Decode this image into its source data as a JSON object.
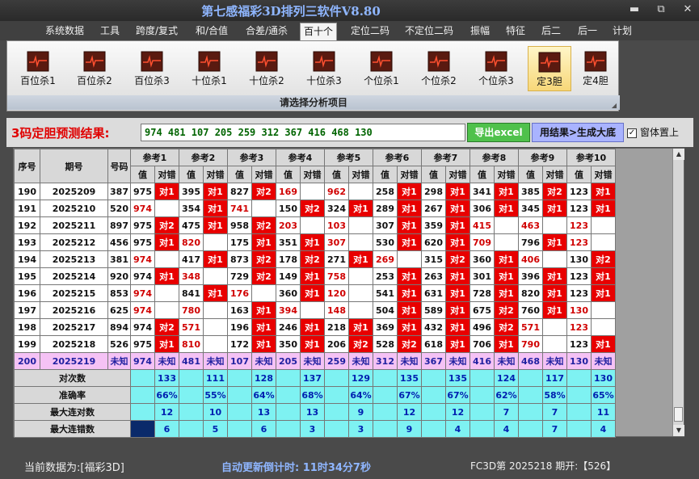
{
  "window": {
    "title": "第七感福彩3D排列三软件V8.80",
    "minimize": "▬",
    "restore": "⧉",
    "close": "✕"
  },
  "menu": [
    "系统数据",
    "工具",
    "跨度/复式",
    "和/合值",
    "合差/通杀",
    "百十个",
    "定位二码",
    "不定位二码",
    "振幅",
    "特征",
    "后二",
    "后一",
    "计划"
  ],
  "menu_active": "百十个",
  "ribbon": {
    "buttons": [
      "百位杀1",
      "百位杀2",
      "百位杀3",
      "十位杀1",
      "十位杀2",
      "十位杀3",
      "个位杀1",
      "个位杀2",
      "个位杀3",
      "定3胆",
      "定4胆"
    ],
    "selected": "定3胆",
    "icon": "chart-icon",
    "caption": "请选择分析项目"
  },
  "result": {
    "label": "3码定胆预测结果:",
    "value": "974 481 107 205 259 312 367 416 468 130",
    "excel_button": "导出excel",
    "generate_button": "用结果>生成大底",
    "topmost_label": "窗体置上",
    "topmost_checked": true
  },
  "table": {
    "col_headers": {
      "seq": "序号",
      "period": "期号",
      "number": "号码"
    },
    "groups": [
      "参考1",
      "参考2",
      "参考3",
      "参考4",
      "参考5",
      "参考6",
      "参考7",
      "参考8",
      "参考9",
      "参考10"
    ],
    "sub_headers": [
      "值",
      "对错"
    ],
    "rows": [
      {
        "seq": "190",
        "period": "2025209",
        "num": "387",
        "cells": [
          [
            "975",
            "对1",
            "dark",
            1
          ],
          [
            "395",
            "对1",
            "dark",
            1
          ],
          [
            "827",
            "对2",
            "dark",
            1
          ],
          [
            "169",
            "",
            "red",
            0
          ],
          [
            "962",
            "",
            "red",
            0
          ],
          [
            "258",
            "对1",
            "dark",
            1
          ],
          [
            "298",
            "对1",
            "dark",
            1
          ],
          [
            "341",
            "对1",
            "dark",
            1
          ],
          [
            "385",
            "对2",
            "dark",
            1
          ],
          [
            "123",
            "对1",
            "dark",
            1
          ]
        ]
      },
      {
        "seq": "191",
        "period": "2025210",
        "num": "520",
        "cells": [
          [
            "974",
            "",
            "red",
            0
          ],
          [
            "354",
            "对1",
            "dark",
            1
          ],
          [
            "741",
            "",
            "red",
            0
          ],
          [
            "150",
            "对2",
            "dark",
            1
          ],
          [
            "324",
            "对1",
            "dark",
            1
          ],
          [
            "289",
            "对1",
            "dark",
            1
          ],
          [
            "267",
            "对1",
            "dark",
            1
          ],
          [
            "306",
            "对1",
            "dark",
            1
          ],
          [
            "345",
            "对1",
            "dark",
            1
          ],
          [
            "123",
            "对1",
            "dark",
            1
          ]
        ]
      },
      {
        "seq": "192",
        "period": "2025211",
        "num": "897",
        "cells": [
          [
            "975",
            "对2",
            "dark",
            1
          ],
          [
            "475",
            "对1",
            "dark",
            1
          ],
          [
            "958",
            "对2",
            "dark",
            1
          ],
          [
            "203",
            "",
            "red",
            0
          ],
          [
            "103",
            "",
            "red",
            0
          ],
          [
            "307",
            "对1",
            "dark",
            1
          ],
          [
            "359",
            "对1",
            "dark",
            1
          ],
          [
            "415",
            "",
            "red",
            0
          ],
          [
            "463",
            "",
            "red",
            0
          ],
          [
            "123",
            "",
            "red",
            0
          ]
        ]
      },
      {
        "seq": "193",
        "period": "2025212",
        "num": "456",
        "cells": [
          [
            "975",
            "对1",
            "dark",
            1
          ],
          [
            "820",
            "",
            "red",
            0
          ],
          [
            "175",
            "对1",
            "dark",
            1
          ],
          [
            "351",
            "对1",
            "dark",
            1
          ],
          [
            "307",
            "",
            "red",
            0
          ],
          [
            "530",
            "对1",
            "dark",
            1
          ],
          [
            "620",
            "对1",
            "dark",
            1
          ],
          [
            "709",
            "",
            "red",
            0
          ],
          [
            "796",
            "对1",
            "dark",
            1
          ],
          [
            "123",
            "",
            "red",
            0
          ]
        ]
      },
      {
        "seq": "194",
        "period": "2025213",
        "num": "381",
        "cells": [
          [
            "974",
            "",
            "red",
            0
          ],
          [
            "417",
            "对1",
            "dark",
            1
          ],
          [
            "873",
            "对2",
            "dark",
            1
          ],
          [
            "178",
            "对2",
            "dark",
            1
          ],
          [
            "271",
            "对1",
            "dark",
            1
          ],
          [
            "269",
            "",
            "red",
            0
          ],
          [
            "315",
            "对2",
            "dark",
            1
          ],
          [
            "360",
            "对1",
            "dark",
            1
          ],
          [
            "406",
            "",
            "red",
            0
          ],
          [
            "130",
            "对2",
            "dark",
            1
          ]
        ]
      },
      {
        "seq": "195",
        "period": "2025214",
        "num": "920",
        "cells": [
          [
            "974",
            "对1",
            "dark",
            1
          ],
          [
            "348",
            "",
            "red",
            0
          ],
          [
            "729",
            "对2",
            "dark",
            1
          ],
          [
            "149",
            "对1",
            "dark",
            1
          ],
          [
            "758",
            "",
            "red",
            0
          ],
          [
            "253",
            "对1",
            "dark",
            1
          ],
          [
            "263",
            "对1",
            "dark",
            1
          ],
          [
            "301",
            "对1",
            "dark",
            1
          ],
          [
            "396",
            "对1",
            "dark",
            1
          ],
          [
            "123",
            "对1",
            "dark",
            1
          ]
        ]
      },
      {
        "seq": "196",
        "period": "2025215",
        "num": "853",
        "cells": [
          [
            "974",
            "",
            "red",
            0
          ],
          [
            "841",
            "对1",
            "dark",
            1
          ],
          [
            "176",
            "",
            "red",
            0
          ],
          [
            "360",
            "对1",
            "dark",
            1
          ],
          [
            "120",
            "",
            "red",
            0
          ],
          [
            "541",
            "对1",
            "dark",
            1
          ],
          [
            "631",
            "对1",
            "dark",
            1
          ],
          [
            "728",
            "对1",
            "dark",
            1
          ],
          [
            "820",
            "对1",
            "dark",
            1
          ],
          [
            "123",
            "对1",
            "dark",
            1
          ]
        ]
      },
      {
        "seq": "197",
        "period": "2025216",
        "num": "625",
        "cells": [
          [
            "974",
            "",
            "red",
            0
          ],
          [
            "780",
            "",
            "red",
            0
          ],
          [
            "163",
            "对1",
            "dark",
            1
          ],
          [
            "394",
            "",
            "red",
            0
          ],
          [
            "148",
            "",
            "red",
            0
          ],
          [
            "504",
            "对1",
            "dark",
            1
          ],
          [
            "589",
            "对1",
            "dark",
            1
          ],
          [
            "675",
            "对2",
            "dark",
            1
          ],
          [
            "760",
            "对1",
            "dark",
            1
          ],
          [
            "130",
            "",
            "red",
            0
          ]
        ]
      },
      {
        "seq": "198",
        "period": "2025217",
        "num": "894",
        "cells": [
          [
            "974",
            "对2",
            "dark",
            1
          ],
          [
            "571",
            "",
            "red",
            0
          ],
          [
            "196",
            "对1",
            "dark",
            1
          ],
          [
            "246",
            "对1",
            "dark",
            1
          ],
          [
            "218",
            "对1",
            "dark",
            1
          ],
          [
            "369",
            "对1",
            "dark",
            1
          ],
          [
            "432",
            "对1",
            "dark",
            1
          ],
          [
            "496",
            "对2",
            "dark",
            1
          ],
          [
            "571",
            "",
            "red",
            0
          ],
          [
            "123",
            "",
            "red",
            0
          ]
        ]
      },
      {
        "seq": "199",
        "period": "2025218",
        "num": "526",
        "cells": [
          [
            "975",
            "对1",
            "dark",
            1
          ],
          [
            "810",
            "",
            "red",
            0
          ],
          [
            "172",
            "对1",
            "dark",
            1
          ],
          [
            "350",
            "对1",
            "dark",
            1
          ],
          [
            "206",
            "对2",
            "dark",
            1
          ],
          [
            "528",
            "对2",
            "dark",
            1
          ],
          [
            "618",
            "对1",
            "dark",
            1
          ],
          [
            "706",
            "对1",
            "dark",
            1
          ],
          [
            "790",
            "",
            "red",
            0
          ],
          [
            "123",
            "对1",
            "dark",
            1
          ]
        ]
      }
    ],
    "unknown_row": {
      "seq": "200",
      "period": "2025219",
      "num": "未知",
      "values": [
        "974",
        "481",
        "107",
        "205",
        "259",
        "312",
        "367",
        "416",
        "468",
        "130"
      ],
      "status": "未知"
    },
    "stats": [
      {
        "label": "对次数",
        "values": [
          "133",
          "111",
          "128",
          "137",
          "129",
          "135",
          "135",
          "124",
          "117",
          "130"
        ]
      },
      {
        "label": "准确率",
        "values": [
          "66%",
          "55%",
          "64%",
          "68%",
          "64%",
          "67%",
          "67%",
          "62%",
          "58%",
          "65%"
        ]
      },
      {
        "label": "最大连对数",
        "values": [
          "12",
          "10",
          "13",
          "13",
          "9",
          "12",
          "12",
          "7",
          "7",
          "11"
        ]
      },
      {
        "label": "最大连错数",
        "values": [
          "6",
          "5",
          "6",
          "3",
          "3",
          "9",
          "4",
          "4",
          "7",
          "4"
        ]
      }
    ]
  },
  "status": {
    "left": "当前数据为:[福彩3D]",
    "countdown": "自动更新倒计时:  11时34分7秒",
    "right": "FC3D第 2025218 期开:【526】"
  },
  "scroll": {
    "up": "▲",
    "down": "▼"
  }
}
